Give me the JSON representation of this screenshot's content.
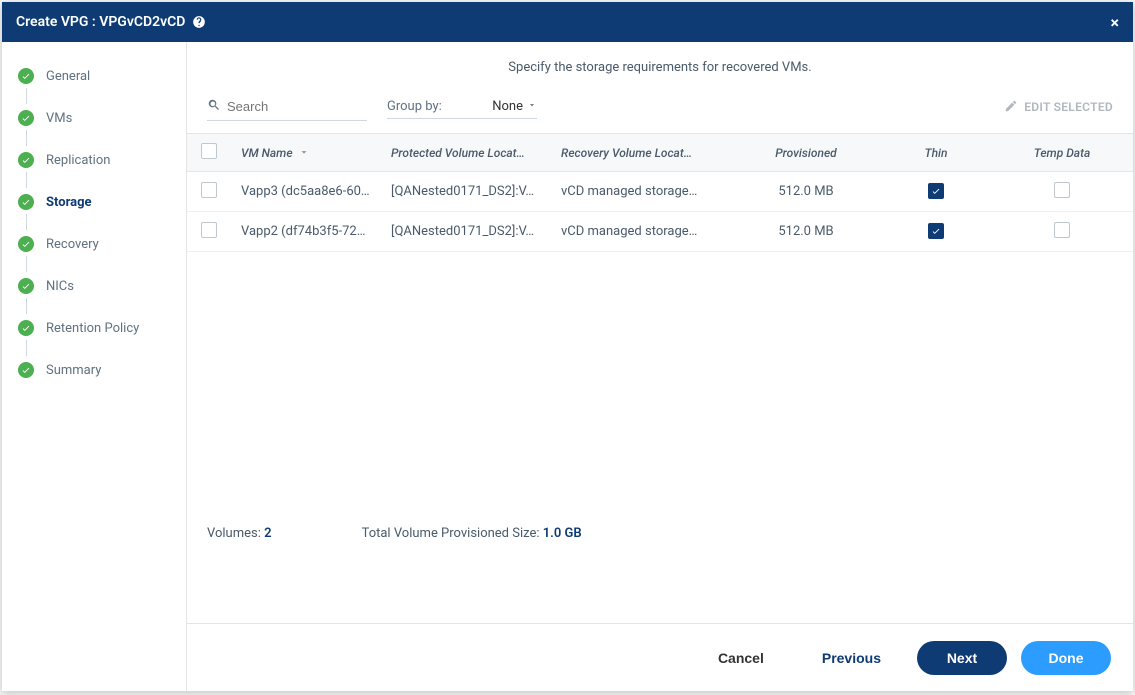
{
  "header": {
    "title": "Create VPG : VPGvCD2vCD"
  },
  "sidebar": {
    "steps": [
      {
        "label": "General"
      },
      {
        "label": "VMs"
      },
      {
        "label": "Replication"
      },
      {
        "label": "Storage",
        "active": true
      },
      {
        "label": "Recovery"
      },
      {
        "label": "NICs"
      },
      {
        "label": "Retention Policy"
      },
      {
        "label": "Summary"
      }
    ]
  },
  "main": {
    "description": "Specify the storage requirements for recovered VMs.",
    "search_placeholder": "Search",
    "groupby_label": "Group by:",
    "groupby_value": "None",
    "edit_selected": "EDIT SELECTED"
  },
  "table": {
    "columns": {
      "vmname": "VM Name",
      "protected": "Protected Volume Locat…",
      "recovery": "Recovery Volume Locat…",
      "provisioned": "Provisioned",
      "thin": "Thin",
      "tempdata": "Temp Data"
    },
    "rows": [
      {
        "vmname": "Vapp3 (dc5aa8e6-60…",
        "protected": "[QANested0171_DS2]:V…",
        "recovery": "vCD managed storage…",
        "provisioned": "512.0 MB",
        "thin": true,
        "tempdata": false
      },
      {
        "vmname": "Vapp2 (df74b3f5-72…",
        "protected": "[QANested0171_DS2]:V…",
        "recovery": "vCD managed storage…",
        "provisioned": "512.0 MB",
        "thin": true,
        "tempdata": false
      }
    ]
  },
  "summary": {
    "volumes_label": "Volumes:",
    "volumes_value": "2",
    "totalsize_label": "Total Volume Provisioned Size:",
    "totalsize_value": "1.0 GB"
  },
  "footer": {
    "cancel": "Cancel",
    "previous": "Previous",
    "next": "Next",
    "done": "Done"
  }
}
